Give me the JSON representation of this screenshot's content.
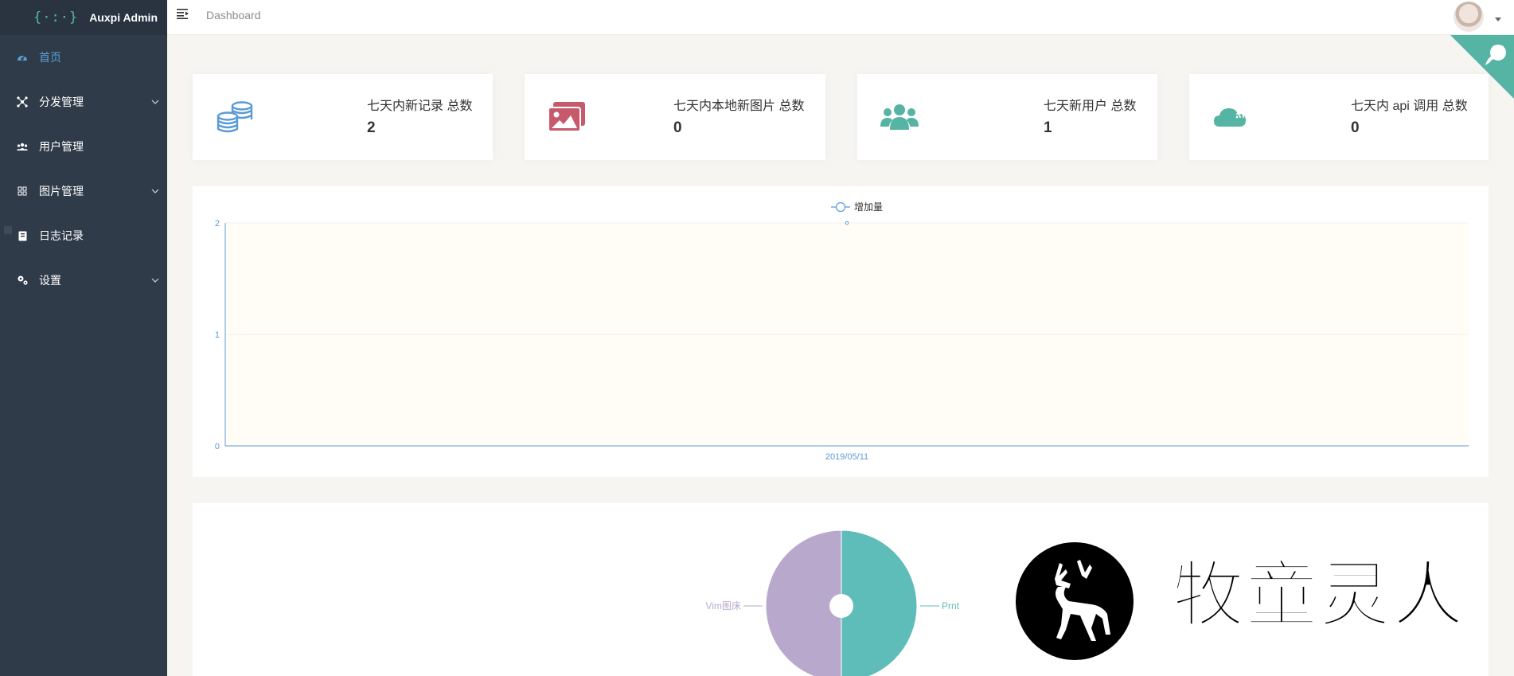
{
  "app": {
    "logo": "{·:·}",
    "name": "Auxpi Admin"
  },
  "header": {
    "breadcrumb": "Dashboard"
  },
  "sidebar": {
    "items": [
      {
        "label": "首页",
        "icon": "dashboard-icon",
        "active": true,
        "has_submenu": false
      },
      {
        "label": "分发管理",
        "icon": "share-nodes-icon",
        "active": false,
        "has_submenu": true
      },
      {
        "label": "用户管理",
        "icon": "users-icon",
        "active": false,
        "has_submenu": false
      },
      {
        "label": "图片管理",
        "icon": "grid-icon",
        "active": false,
        "has_submenu": true
      },
      {
        "label": "日志记录",
        "icon": "book-icon",
        "active": false,
        "has_submenu": false
      },
      {
        "label": "设置",
        "icon": "gears-icon",
        "active": false,
        "has_submenu": true
      }
    ]
  },
  "stats": [
    {
      "title": "七天内新记录 总数",
      "value": "2",
      "icon": "database-icon",
      "color": "#5b9bd5"
    },
    {
      "title": "七天内本地新图片 总数",
      "value": "0",
      "icon": "images-icon",
      "color": "#c75a6a"
    },
    {
      "title": "七天新用户 总数",
      "value": "1",
      "icon": "users-icon",
      "color": "#55b4a3"
    },
    {
      "title": "七天内 api 调用 总数",
      "value": "0",
      "icon": "cloud-signal-icon",
      "color": "#55b4a3"
    }
  ],
  "chart_data": [
    {
      "type": "line",
      "series": [
        {
          "name": "增加量",
          "x": [
            "2019/05/11"
          ],
          "values": [
            2
          ]
        }
      ],
      "categories": [
        "2019/05/11"
      ],
      "yticks": [
        0,
        1,
        2
      ],
      "ylim": [
        0,
        2
      ],
      "legend": "top-center",
      "grid": true,
      "colors": {
        "line": "#5b9bd5",
        "area": "#fffdf6"
      }
    },
    {
      "type": "pie",
      "labels": [
        "Vim图床",
        "Prnt"
      ],
      "values": [
        1,
        1
      ],
      "colors": [
        "#b8a9cc",
        "#5fbdb9"
      ]
    }
  ],
  "watermark": {
    "text": "牧童灵人"
  }
}
